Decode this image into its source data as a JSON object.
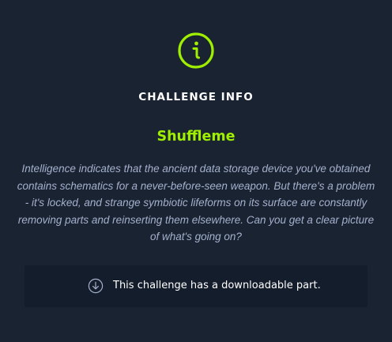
{
  "header": {
    "icon": "info-icon",
    "title": "CHALLENGE INFO"
  },
  "challenge": {
    "name": "Shuffleme",
    "description": "Intelligence indicates that the ancient data storage device you've obtained contains schematics for a never-before-seen weapon. But there's a problem - it's locked, and strange symbiotic lifeforms on its surface are constantly removing parts and reinserting them elsewhere. Can you get a clear picture of what's going on?"
  },
  "download": {
    "icon": "download-icon",
    "text": "This challenge has a downloadable part."
  },
  "colors": {
    "background": "#1a2332",
    "accent": "#9fef00",
    "description_text": "#a4b1cd",
    "download_box": "#141d2b"
  }
}
